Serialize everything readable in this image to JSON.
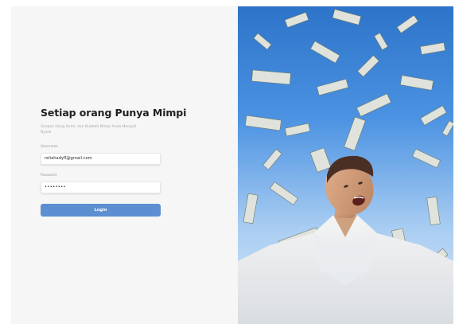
{
  "login": {
    "title": "Setiap orang Punya Mimpi",
    "subtitle": "Simpan Uang Anda, dan Buatlah Mimpi Anda Menjadi Nyata",
    "username_label": "Username",
    "username_value": "reliahadyfl@gmail.com",
    "password_label": "Password",
    "password_value": "••••••••",
    "login_button": "Login"
  },
  "hero_image": {
    "description_icon": "money-rain-photo-icon"
  },
  "colors": {
    "accent": "#5b8fd1",
    "panel_bg": "#f6f6f6",
    "sky_top": "#2d74c9",
    "sky_bottom": "#dbe9f7"
  }
}
